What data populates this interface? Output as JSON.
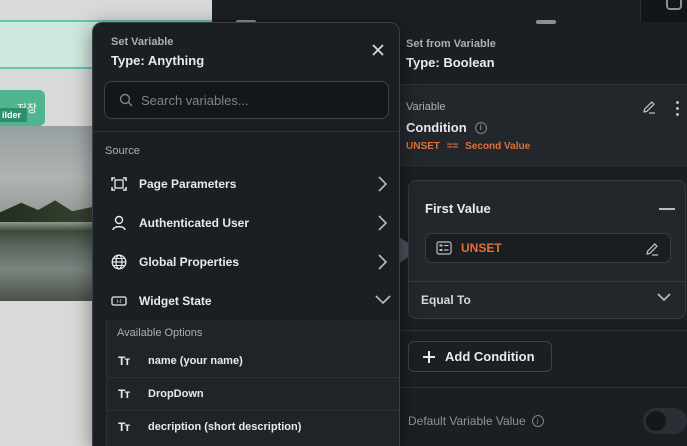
{
  "canvas": {
    "save_button": "저장",
    "builder_tag": "ilder"
  },
  "set_variable_popup": {
    "header_small": "Set Variable",
    "type_title": "Type: Anything",
    "search_placeholder": "Search variables...",
    "source_label": "Source",
    "sources": [
      {
        "label": "Page Parameters",
        "icon": "page-parameters-icon",
        "chevron": "right"
      },
      {
        "label": "Authenticated User",
        "icon": "user-icon",
        "chevron": "right"
      },
      {
        "label": "Global Properties",
        "icon": "globe-icon",
        "chevron": "right"
      },
      {
        "label": "Widget State",
        "icon": "widget-state-icon",
        "chevron": "down"
      }
    ],
    "available_options_label": "Available Options",
    "options": [
      {
        "type_icon": "Tт",
        "label": "name (your name)"
      },
      {
        "type_icon": "Tт",
        "label": "DropDown"
      },
      {
        "type_icon": "Tт",
        "label": "decription (short description)"
      }
    ]
  },
  "set_from_variable_panel": {
    "header_small": "Set from Variable",
    "type_title": "Type: Boolean",
    "variable_label": "Variable",
    "variable_name": "Condition",
    "expression_left": "UNSET",
    "expression_operator": "==",
    "expression_right": "Second Value",
    "first_value_label": "First Value",
    "first_value": "UNSET",
    "comparator": "Equal To",
    "add_condition_label": "Add Condition",
    "default_variable_value_label": "Default Variable Value",
    "default_toggle_on": false
  },
  "colors": {
    "accent_orange": "#e0703a",
    "panel_bg": "#1b1f23",
    "card_bg": "#22272c"
  }
}
